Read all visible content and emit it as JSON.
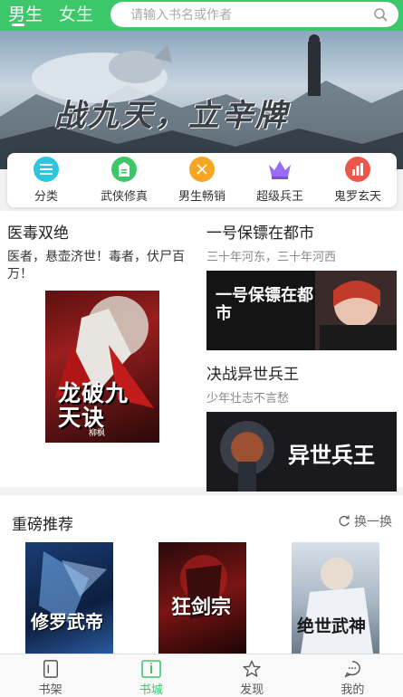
{
  "colors": {
    "brand": "#3cc86a",
    "accent_yellow": "#f6a623",
    "accent_purple": "#9a6cf2",
    "accent_red": "#f0554a",
    "accent_teal": "#2dc6e0"
  },
  "header": {
    "tab_male": "男生",
    "tab_female": "女生",
    "search_placeholder": "请输入书名或作者"
  },
  "banner": {
    "title": "战九天，立辛牌"
  },
  "quicknav": [
    {
      "label": "分类",
      "icon": "category-icon"
    },
    {
      "label": "武侠修真",
      "icon": "martial-icon"
    },
    {
      "label": "男生畅销",
      "icon": "bestseller-icon"
    },
    {
      "label": "超级兵王",
      "icon": "crown-icon"
    },
    {
      "label": "鬼罗玄天",
      "icon": "chart-icon"
    }
  ],
  "featured": {
    "left": {
      "title": "医毒双绝",
      "description": "医者，悬壶济世！毒者，伏尸百万！",
      "cover_text": "龙破九天诀",
      "cover_author": "柳枫"
    },
    "right": [
      {
        "title": "一号保镖在都市",
        "subtitle": "三十年河东，三十年河西",
        "banner_text": "一号保镖在都市"
      },
      {
        "title": "决战异世兵王",
        "subtitle": "少年壮志不言愁",
        "banner_text": "异世兵王"
      }
    ]
  },
  "recommend": {
    "title": "重磅推荐",
    "refresh_label": "换一换",
    "books": [
      {
        "cover_text": "修罗武帝"
      },
      {
        "cover_text": "狂剑宗"
      },
      {
        "cover_text": "绝世武神"
      }
    ]
  },
  "tabbar": [
    {
      "label": "书架",
      "icon": "bookshelf-icon"
    },
    {
      "label": "书城",
      "icon": "bookstore-icon"
    },
    {
      "label": "发现",
      "icon": "star-icon"
    },
    {
      "label": "我的",
      "icon": "profile-icon"
    }
  ]
}
